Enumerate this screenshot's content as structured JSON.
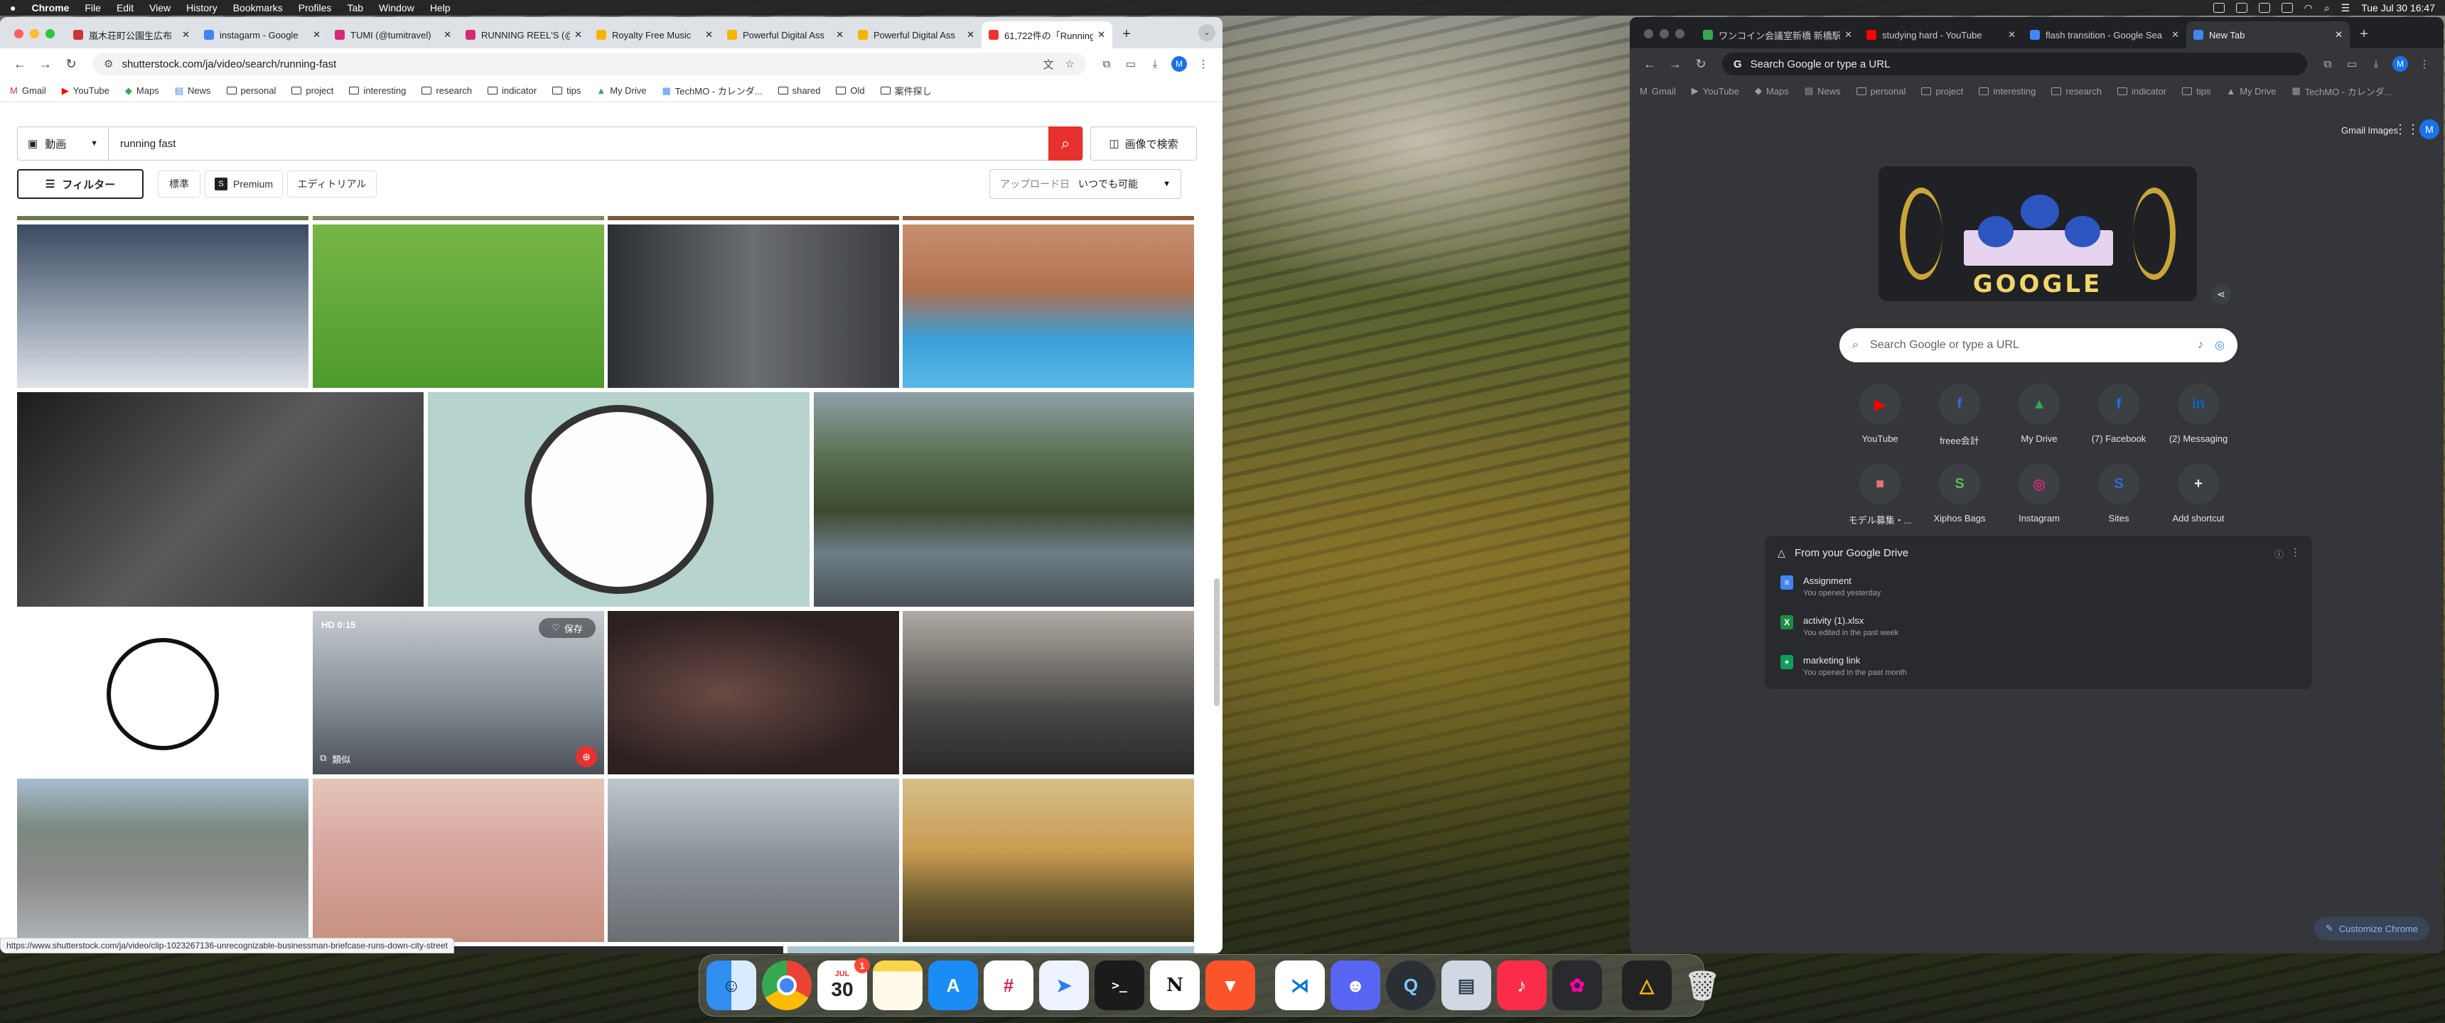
{
  "menubar": {
    "app": "Chrome",
    "items": [
      "File",
      "Edit",
      "View",
      "History",
      "Bookmarks",
      "Profiles",
      "Tab",
      "Window",
      "Help"
    ],
    "clock": "Tue Jul 30  16:47"
  },
  "left": {
    "tabs": [
      {
        "title": "嵐木荘町公園生広布",
        "color": "#c33"
      },
      {
        "title": "instagarm - Google",
        "color": "#4285f4"
      },
      {
        "title": "TUMI (@tumitravel)",
        "color": "#d62976"
      },
      {
        "title": "RUNNING REEL'S (@",
        "color": "#d62976"
      },
      {
        "title": "Royalty Free Music",
        "color": "#f4b400"
      },
      {
        "title": "Powerful Digital Ass",
        "color": "#f4b400"
      },
      {
        "title": "Powerful Digital Ass",
        "color": "#f4b400"
      },
      {
        "title": "61,722件の「Running",
        "color": "#e33"
      }
    ],
    "url": "shutterstock.com/ja/video/search/running-fast",
    "bookmarks": [
      "Gmail",
      "YouTube",
      "Maps",
      "News",
      "personal",
      "project",
      "interesting",
      "research",
      "indicator",
      "tips",
      "My Drive",
      "TechMO - カレンダ...",
      "shared",
      "Old",
      "案件探し"
    ],
    "search": {
      "type": "動画",
      "query": "running fast",
      "image_search": "画像で検索"
    },
    "filters": {
      "filter": "フィルター",
      "standard": "標準",
      "premium": "Premium",
      "editorial": "エディトリアル",
      "upload_label": "アップロード日",
      "upload_value": "いつでも可能"
    },
    "hover_clip": {
      "duration": "HD 0:15",
      "save": "保存",
      "similar": "類似"
    },
    "status_url": "https://www.shutterstock.com/ja/video/clip-1023267136-unrecognizable-businessman-briefcase-runs-down-city-street"
  },
  "right": {
    "tabs": [
      {
        "title": "ワンコイン会議室新橋 新橋駅前",
        "color": "#34a853"
      },
      {
        "title": "studying hard - YouTube",
        "color": "#f00"
      },
      {
        "title": "flash transition - Google Sea",
        "color": "#4285f4"
      },
      {
        "title": "New Tab",
        "color": "#4285f4"
      }
    ],
    "omnibox_placeholder": "Search Google or type a URL",
    "bookmarks": [
      "Gmail",
      "YouTube",
      "Maps",
      "News",
      "personal",
      "project",
      "interesting",
      "research",
      "indicator",
      "tips",
      "My Drive",
      "TechMO - カレンダ..."
    ],
    "top_links": [
      "Gmail",
      "Images"
    ],
    "avatar": "M",
    "doodle": "GOOGLE",
    "search_placeholder": "Search Google or type a URL",
    "shortcuts": [
      {
        "label": "YouTube",
        "glyph": "▶",
        "color": "#f00"
      },
      {
        "label": "freee会計",
        "glyph": "f",
        "color": "#2f6ee0"
      },
      {
        "label": "My Drive",
        "glyph": "▲",
        "color": "#34a853"
      },
      {
        "label": "(7) Facebook",
        "glyph": "f",
        "color": "#1877f2"
      },
      {
        "label": "(2) Messaging",
        "glyph": "in",
        "color": "#0a66c2"
      },
      {
        "label": "モデル募集・...",
        "glyph": "■",
        "color": "#e57373"
      },
      {
        "label": "Xiphos Bags",
        "glyph": "S",
        "color": "#5cb85c"
      },
      {
        "label": "Instagram",
        "glyph": "◎",
        "color": "#d62976"
      },
      {
        "label": "Sites",
        "glyph": "S",
        "color": "#3367d6"
      },
      {
        "label": "Add shortcut",
        "glyph": "+",
        "color": "#3c4043"
      }
    ],
    "drive": {
      "title": "From your Google Drive",
      "items": [
        {
          "name": "Assignment",
          "sub": "You opened yesterday",
          "icon": "≡",
          "color": "#4285f4"
        },
        {
          "name": "activity (1).xlsx",
          "sub": "You edited in the past week",
          "icon": "X",
          "color": "#1e8e3e"
        },
        {
          "name": "marketing link",
          "sub": "You opened in the past month",
          "icon": "+",
          "color": "#0f9d58"
        }
      ]
    },
    "customize": "Customize Chrome"
  },
  "dock": {
    "calendar_month": "JUL",
    "calendar_day": "30",
    "calendar_badge": "1"
  }
}
